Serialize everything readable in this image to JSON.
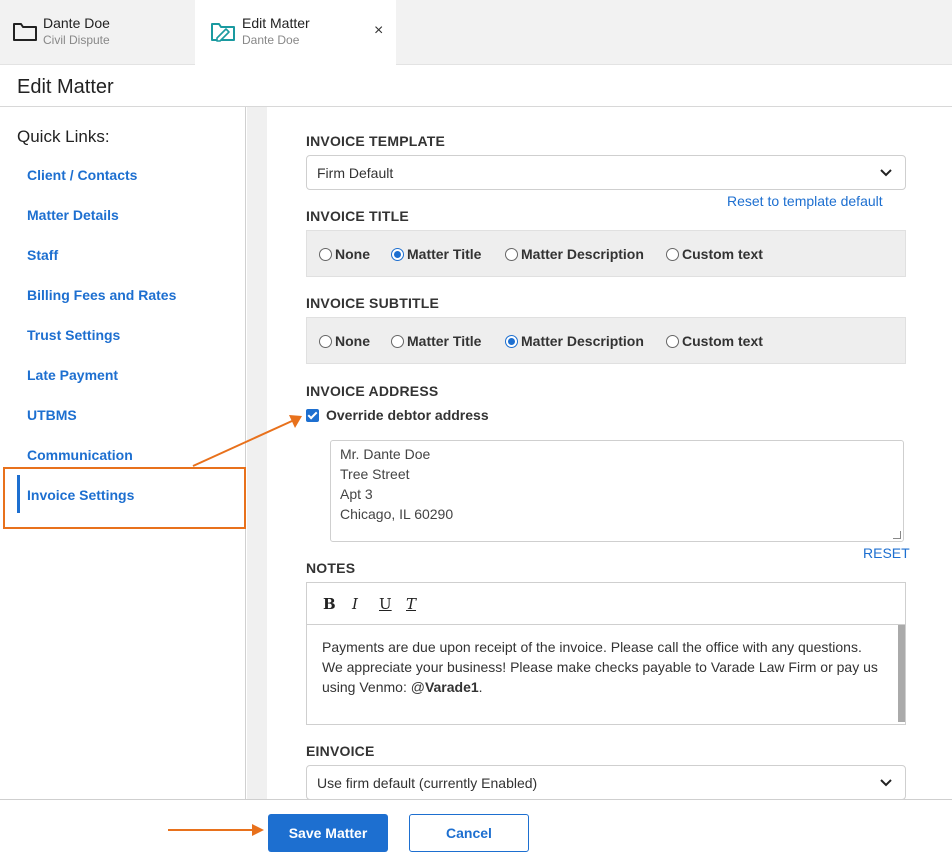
{
  "tabs": [
    {
      "title": "Dante Doe",
      "subtitle": "Civil Dispute",
      "icon": "folder-icon"
    },
    {
      "title": "Edit Matter",
      "subtitle": "Dante Doe",
      "icon": "edit-folder-icon",
      "close": "×"
    }
  ],
  "page": {
    "title": "Edit Matter"
  },
  "sidebar": {
    "heading": "Quick Links:",
    "items": [
      {
        "label": "Client / Contacts"
      },
      {
        "label": "Matter Details"
      },
      {
        "label": "Staff"
      },
      {
        "label": "Billing Fees and Rates"
      },
      {
        "label": "Trust Settings"
      },
      {
        "label": "Late Payment"
      },
      {
        "label": "UTBMS"
      },
      {
        "label": "Communication"
      },
      {
        "label": "Invoice Settings",
        "active": true
      }
    ]
  },
  "invoice_template": {
    "label": "INVOICE TEMPLATE",
    "value": "Firm Default",
    "reset_link": "Reset to template default"
  },
  "invoice_title": {
    "label": "INVOICE TITLE",
    "options": [
      "None",
      "Matter Title",
      "Matter Description",
      "Custom text"
    ],
    "selected": "Matter Title"
  },
  "invoice_subtitle": {
    "label": "INVOICE SUBTITLE",
    "options": [
      "None",
      "Matter Title",
      "Matter Description",
      "Custom text"
    ],
    "selected": "Matter Description"
  },
  "invoice_address": {
    "label": "INVOICE ADDRESS",
    "override_label": "Override debtor address",
    "override_checked": true,
    "lines": [
      "Mr. Dante Doe",
      "Tree Street",
      "Apt 3",
      "Chicago, IL 60290"
    ],
    "reset": "RESET"
  },
  "notes": {
    "label": "NOTES",
    "toolbar": {
      "bold": "B",
      "italic": "I",
      "underline": "U",
      "clear": "T"
    },
    "text_before": "Payments are due upon receipt of the invoice. Please call the office with any questions. We appreciate your business! Please make checks payable to Varade Law Firm or pay us using Venmo: @",
    "text_bold": "Varade1",
    "text_after": "."
  },
  "einvoice": {
    "label": "EINVOICE",
    "value": "Use firm default (currently Enabled)"
  },
  "footer": {
    "save": "Save Matter",
    "cancel": "Cancel"
  },
  "colors": {
    "accent": "#1d6fd0",
    "annotation": "#e8711c"
  }
}
